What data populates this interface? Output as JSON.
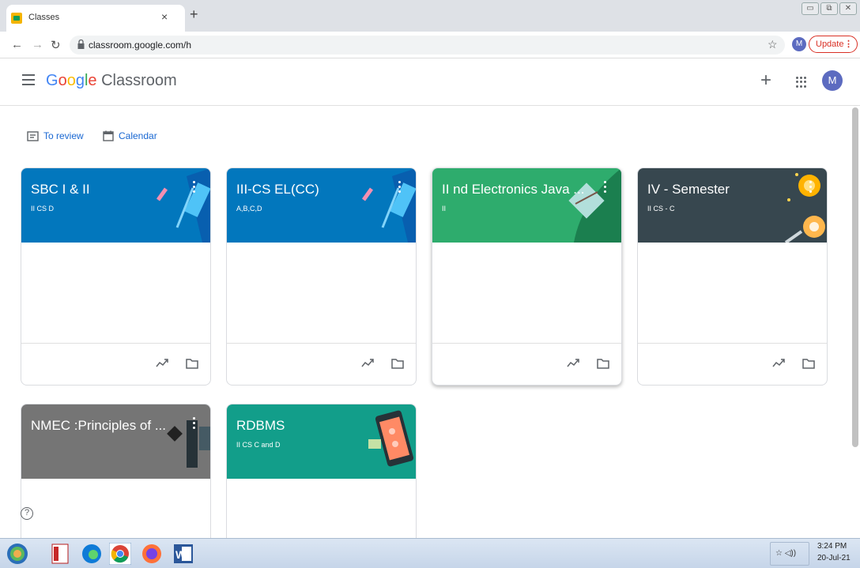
{
  "browser": {
    "tab_title": "Classes",
    "tab_close": "×",
    "new_tab": "+",
    "url": "classroom.google.com/h",
    "profile_initial": "M",
    "update_label": "Update",
    "update_dots": "⋮",
    "win_controls": [
      "▭",
      "⧉",
      "✕"
    ]
  },
  "header": {
    "logo_g": "G",
    "logo_o1": "o",
    "logo_o2": "o",
    "logo_g2": "g",
    "logo_l": "l",
    "logo_e": "e",
    "logo_product": " Classroom",
    "plus": "+",
    "avatar_initial": "M"
  },
  "links": {
    "to_review": "To review",
    "calendar": "Calendar"
  },
  "cards": [
    {
      "title": "SBC I & II",
      "subtitle": "II CS D",
      "color": "#0277bd"
    },
    {
      "title": "III-CS EL(CC)",
      "subtitle": "A,B,C,D",
      "color": "#0277bd"
    },
    {
      "title": "II nd Electronics Java ...",
      "subtitle": "II",
      "color": "#2eac6d"
    },
    {
      "title": "IV - Semester",
      "subtitle": "II CS - C",
      "color": "#37474f"
    },
    {
      "title": "NMEC :Principles of ...",
      "subtitle": "",
      "color": "#757575"
    },
    {
      "title": "RDBMS",
      "subtitle": "II CS C and D",
      "color": "#129e8a"
    }
  ],
  "help": "?",
  "taskbar": {
    "time": "3:24 PM",
    "date": "20-Jul-21",
    "tray": "☆ ◁))"
  }
}
